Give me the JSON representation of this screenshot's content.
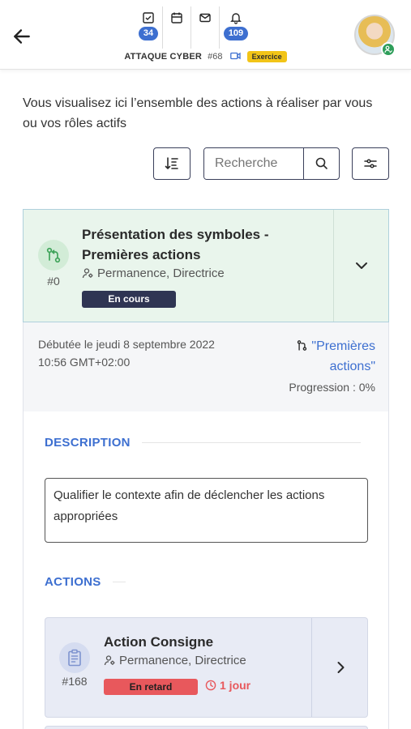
{
  "header": {
    "back_icon": "arrow-left-icon",
    "icons": [
      {
        "name": "checklist-icon",
        "count": "34"
      },
      {
        "name": "calendar-icon",
        "count": ""
      },
      {
        "name": "mail-icon",
        "count": ""
      },
      {
        "name": "bell-icon",
        "count": "109"
      }
    ],
    "event_name": "ATTAQUE CYBER",
    "event_number": "#68",
    "event_mode_icon": "video-icon",
    "exercise_badge": "Exercice",
    "avatar_status_icon": "user-check-icon"
  },
  "intro_text": "Vous visualisez ici l’ensemble des actions à réaliser par vous ou vos rôles actifs",
  "toolbar": {
    "sort_icon": "sort-icon",
    "search_placeholder": "Recherche",
    "search_icon": "search-icon",
    "filter_icon": "sliders-icon"
  },
  "action": {
    "icon": "branch-icon",
    "number": "#0",
    "title": "Présentation des symboles - Premières actions",
    "roles": "Permanence, Directrice",
    "status": "En cours",
    "started_line1": "Débutée le jeudi 8 septembre 2022",
    "started_line2": "10:56 GMT+02:00",
    "phase_link": "\"Premières actions\"",
    "progress": "Progression : 0%",
    "description_label": "DESCRIPTION",
    "description": "Qualifier le contexte afin de déclencher les actions appropriées",
    "actions_label": "ACTIONS",
    "sub_actions": [
      {
        "icon": "clipboard-icon",
        "number": "#168",
        "title": "Action Consigne",
        "roles": "Permanence, Directrice",
        "status": "En retard",
        "delay": "1 jour"
      }
    ]
  },
  "colors": {
    "accent": "#3d6fd0",
    "in_progress_bg": "#e9f5ec",
    "status_dark": "#2f3553",
    "late": "#e8585c",
    "exercise": "#f2c417"
  }
}
